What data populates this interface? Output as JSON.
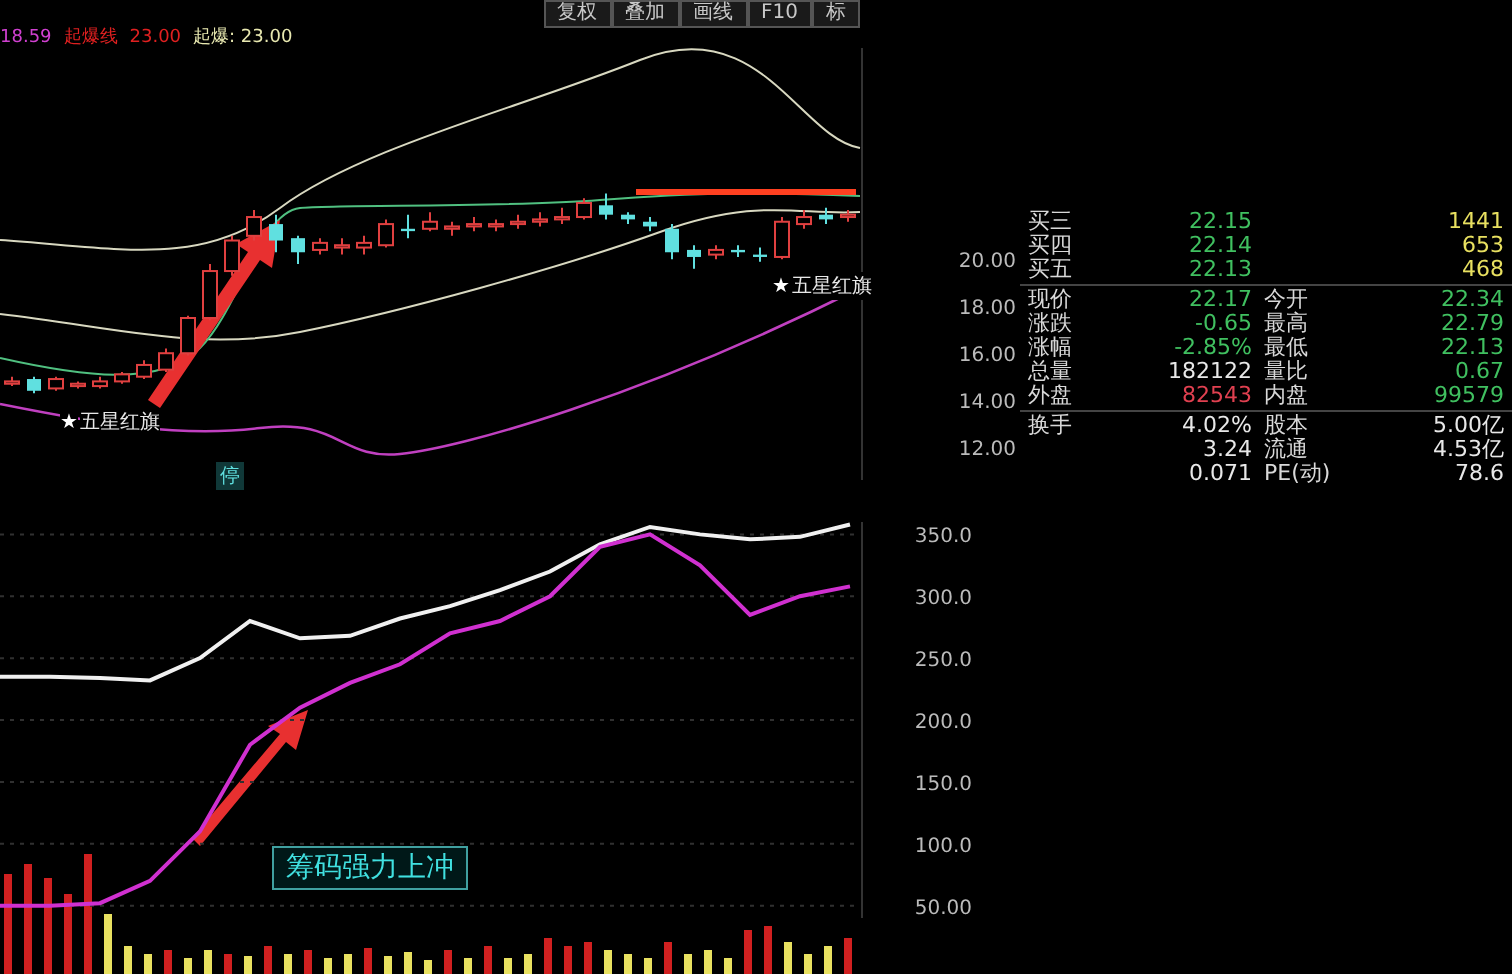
{
  "header": {
    "legend": [
      {
        "text": "18.59",
        "color": "#d040d0"
      },
      {
        "text": "起爆线",
        "color": "#e02020"
      },
      {
        "text": "23.00",
        "color": "#e02020"
      },
      {
        "text": "起爆: 23.00",
        "color": "#e8e8b0"
      }
    ],
    "toolbar": [
      "复权",
      "叠加",
      "画线",
      "F10",
      "标"
    ]
  },
  "main_chart": {
    "signals": [
      {
        "marker": "★",
        "label": "五星红旗"
      },
      {
        "marker": "★",
        "label": "五星红旗"
      }
    ],
    "stop_tag": "停",
    "chart_data": {
      "type": "candlestick",
      "ylim": [
        10.6,
        29.0
      ],
      "ohlc": [
        [
          14.7,
          15.0,
          14.6,
          14.8
        ],
        [
          14.9,
          15.0,
          14.3,
          14.4
        ],
        [
          14.5,
          15.0,
          14.4,
          14.9
        ],
        [
          14.6,
          14.8,
          14.5,
          14.7
        ],
        [
          14.6,
          15.0,
          14.5,
          14.8
        ],
        [
          14.8,
          15.2,
          14.7,
          15.1
        ],
        [
          15.0,
          15.7,
          14.9,
          15.5
        ],
        [
          15.3,
          16.2,
          15.2,
          16.0
        ],
        [
          16.0,
          17.6,
          15.9,
          17.5
        ],
        [
          17.5,
          19.8,
          17.4,
          19.5
        ],
        [
          19.5,
          21.0,
          19.3,
          20.8
        ],
        [
          21.0,
          22.1,
          20.8,
          21.8
        ],
        [
          21.5,
          21.9,
          20.3,
          20.8
        ],
        [
          20.9,
          21.0,
          19.8,
          20.3
        ],
        [
          20.4,
          20.9,
          20.2,
          20.7
        ],
        [
          20.5,
          20.9,
          20.2,
          20.6
        ],
        [
          20.5,
          21.0,
          20.2,
          20.7
        ],
        [
          20.6,
          21.7,
          20.5,
          21.5
        ],
        [
          21.3,
          21.9,
          20.9,
          21.2
        ],
        [
          21.3,
          22.0,
          21.2,
          21.6
        ],
        [
          21.3,
          21.6,
          21.0,
          21.4
        ],
        [
          21.4,
          21.8,
          21.2,
          21.5
        ],
        [
          21.4,
          21.7,
          21.2,
          21.5
        ],
        [
          21.5,
          21.9,
          21.3,
          21.6
        ],
        [
          21.6,
          22.0,
          21.4,
          21.7
        ],
        [
          21.7,
          22.2,
          21.5,
          21.8
        ],
        [
          21.8,
          22.6,
          21.7,
          22.4
        ],
        [
          22.3,
          22.8,
          21.7,
          21.9
        ],
        [
          21.9,
          22.0,
          21.5,
          21.7
        ],
        [
          21.6,
          21.8,
          21.2,
          21.4
        ],
        [
          21.3,
          21.5,
          20.0,
          20.3
        ],
        [
          20.4,
          20.6,
          19.6,
          20.1
        ],
        [
          20.2,
          20.6,
          20.0,
          20.4
        ],
        [
          20.4,
          20.6,
          20.1,
          20.3
        ],
        [
          20.2,
          20.5,
          19.9,
          20.1
        ],
        [
          20.1,
          21.8,
          20.0,
          21.6
        ],
        [
          21.5,
          22.1,
          21.3,
          21.8
        ],
        [
          21.9,
          22.2,
          21.5,
          21.7
        ],
        [
          21.8,
          22.1,
          21.6,
          21.9
        ]
      ],
      "yticks": [
        {
          "value": 20,
          "label": "20.00"
        },
        {
          "value": 18,
          "label": "18.00"
        },
        {
          "value": 16,
          "label": "16.00"
        },
        {
          "value": 14,
          "label": "14.00"
        },
        {
          "value": 12,
          "label": "12.00"
        }
      ]
    }
  },
  "quote_panel": {
    "order_rows": [
      {
        "label": "买三",
        "price": {
          "text": "22.15",
          "color": "#40c060"
        },
        "volume": "1441"
      },
      {
        "label": "买四",
        "price": {
          "text": "22.14",
          "color": "#40c060"
        },
        "volume": "653"
      },
      {
        "label": "买五",
        "price": {
          "text": "22.13",
          "color": "#40c060"
        },
        "volume": "468"
      }
    ],
    "stat_rows": [
      {
        "label": "现价",
        "value": {
          "text": "22.17",
          "color": "#40c060"
        },
        "label_2": "今开",
        "value_2": {
          "text": "22.34",
          "color": "#40c060"
        }
      },
      {
        "label": "涨跌",
        "value": {
          "text": "-0.65",
          "color": "#40c060"
        },
        "label_2": "最高",
        "value_2": {
          "text": "22.79",
          "color": "#40c060"
        }
      },
      {
        "label": "涨幅",
        "value": {
          "text": "-2.85%",
          "color": "#40c060"
        },
        "label_2": "最低",
        "value_2": {
          "text": "22.13",
          "color": "#40c060"
        }
      },
      {
        "label": "总量",
        "value": {
          "text": "182122",
          "color": "#e8e8e8"
        },
        "label_2": "量比",
        "value_2": {
          "text": "0.67",
          "color": "#40c060"
        }
      },
      {
        "label": "外盘",
        "value": {
          "text": "82543",
          "color": "#e04050"
        },
        "label_2": "内盘",
        "value_2": {
          "text": "99579",
          "color": "#40c060"
        }
      }
    ],
    "extra_rows": [
      {
        "label": "换手",
        "value": "4.02%",
        "label_2": "股本",
        "value_2": "5.00亿"
      },
      {
        "value": "3.24",
        "label_2": "流通",
        "value_2": "4.53亿"
      },
      {
        "value": "0.071",
        "label_2": "PE(动)",
        "value_2": "78.6"
      }
    ]
  },
  "indicator_chart": {
    "annotation": "筹码强力上冲",
    "chart_data": {
      "type": "line",
      "grid": true,
      "ylim": [
        40,
        360
      ],
      "yticks": [
        {
          "value": 350,
          "label": "350.0"
        },
        {
          "value": 300,
          "label": "300.0"
        },
        {
          "value": 250,
          "label": "250.0"
        },
        {
          "value": 200,
          "label": "200.0"
        },
        {
          "value": 150,
          "label": "150.0"
        },
        {
          "value": 100,
          "label": "100.0"
        },
        {
          "value": 50,
          "label": "50.00"
        }
      ],
      "series": [
        {
          "color": "#f0f0f0",
          "values": [
            235,
            235,
            234,
            232,
            250,
            280,
            266,
            268,
            282,
            292,
            305,
            320,
            342,
            356,
            350,
            346,
            348,
            358
          ]
        },
        {
          "color": "#d030d0",
          "values": [
            50,
            50,
            52,
            70,
            110,
            180,
            210,
            230,
            245,
            270,
            280,
            300,
            340,
            350,
            325,
            285,
            300,
            308
          ]
        }
      ]
    }
  }
}
